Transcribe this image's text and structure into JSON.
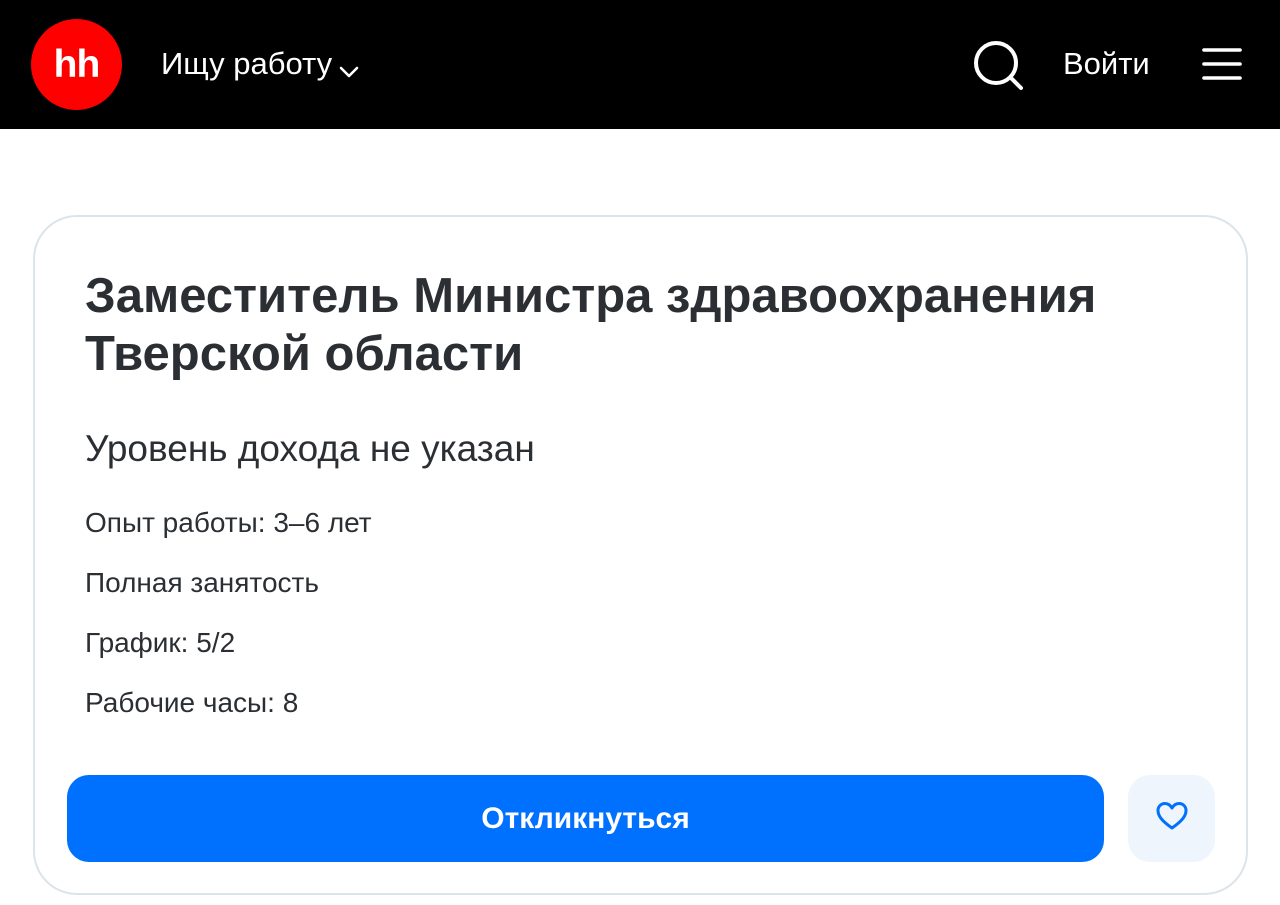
{
  "header": {
    "logo_text": "hh",
    "role_label": "Ищу работу",
    "login_label": "Войти",
    "brand_color": "#ff0000",
    "icons": [
      "chevron-down-icon",
      "search-icon",
      "menu-icon"
    ]
  },
  "vacancy": {
    "title": "Заместитель Министра здравоохранения Тверской области",
    "salary": "Уровень дохода не указан",
    "details": [
      "Опыт работы: 3–6 лет",
      "Полная занятость",
      "График: 5/2",
      "Рабочие часы: 8"
    ],
    "apply_label": "Откликнуться",
    "accent_color": "#0070ff",
    "favorite_icon": "heart-icon"
  }
}
